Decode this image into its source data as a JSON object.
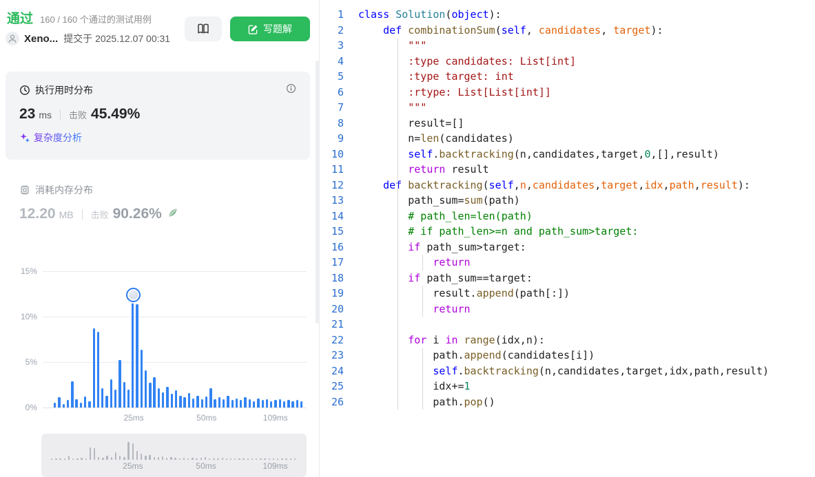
{
  "header": {
    "status": "通过",
    "cases": "160 / 160 个通过的测试用例",
    "username": "Xeno...",
    "submitted": "提交于 2025.12.07 00:31",
    "solution_button": "写题解"
  },
  "runtime": {
    "title": "执行用时分布",
    "value": "23",
    "unit": "ms",
    "beats_label": "击败",
    "beats": "45.49%",
    "complexity_link": "复杂度分析"
  },
  "memory": {
    "title": "消耗内存分布",
    "value": "12.20",
    "unit": "MB",
    "beats_label": "击败",
    "beats": "90.26%"
  },
  "colors": {
    "accent_green": "#2cbb5d",
    "bar_blue": "#3183f3",
    "complexity_gradient": [
      "#7c3aed",
      "#3b82f6"
    ]
  },
  "chart_data": {
    "type": "bar",
    "title": "执行用时分布",
    "x_unit": "ms",
    "ylim": [
      0,
      15.5
    ],
    "grid": true,
    "y_ticks": [
      {
        "label": "15%",
        "value": 15
      },
      {
        "label": "10%",
        "value": 10
      },
      {
        "label": "5%",
        "value": 5
      },
      {
        "label": "0%",
        "value": 0
      }
    ],
    "x_ticks": [
      {
        "label": "25ms",
        "pos": 0.345
      },
      {
        "label": "50ms",
        "pos": 0.621
      },
      {
        "label": "109ms",
        "pos": 0.882
      }
    ],
    "values": [
      0.5,
      1.1,
      0.4,
      0.8,
      2.9,
      0.9,
      0.5,
      1.2,
      0.7,
      8.7,
      8.3,
      2.1,
      1.3,
      3.1,
      2.0,
      5.2,
      2.8,
      2.0,
      12.4,
      11.4,
      6.4,
      4.1,
      2.7,
      3.3,
      2.1,
      1.7,
      2.3,
      1.5,
      1.9,
      1.3,
      1.1,
      1.6,
      1.0,
      1.3,
      0.9,
      1.2,
      2.1,
      0.9,
      1.1,
      0.9,
      1.3,
      0.8,
      1.0,
      0.8,
      1.1,
      0.9,
      0.7,
      1.0,
      0.8,
      0.9,
      0.7,
      0.8,
      0.9,
      0.7,
      0.8,
      0.7,
      0.8,
      0.7
    ],
    "marker_index": 18
  },
  "code": {
    "lines": [
      [
        [
          "kw",
          "class"
        ],
        [
          "p",
          " "
        ],
        [
          "cls",
          "Solution"
        ],
        [
          "p",
          "("
        ],
        [
          "kw",
          "object"
        ],
        [
          "p",
          "):"
        ]
      ],
      [
        [
          "p",
          "    "
        ],
        [
          "kw",
          "def"
        ],
        [
          "p",
          " "
        ],
        [
          "fn",
          "combinationSum"
        ],
        [
          "p",
          "("
        ],
        [
          "kw",
          "self"
        ],
        [
          "p",
          ", "
        ],
        [
          "prm",
          "candidates"
        ],
        [
          "p",
          ", "
        ],
        [
          "prm",
          "target"
        ],
        [
          "p",
          "):"
        ]
      ],
      [
        [
          "str",
          "        \"\"\""
        ]
      ],
      [
        [
          "str",
          "        :type candidates: List[int]"
        ]
      ],
      [
        [
          "str",
          "        :type target: int"
        ]
      ],
      [
        [
          "str",
          "        :rtype: List[List[int]]"
        ]
      ],
      [
        [
          "str",
          "        \"\"\""
        ]
      ],
      [
        [
          "p",
          "        result=[]"
        ]
      ],
      [
        [
          "p",
          "        n="
        ],
        [
          "fn",
          "len"
        ],
        [
          "p",
          "(candidates)"
        ]
      ],
      [
        [
          "p",
          "        "
        ],
        [
          "kw",
          "self"
        ],
        [
          "p",
          "."
        ],
        [
          "fn",
          "backtracking"
        ],
        [
          "p",
          "(n,candidates,target,"
        ],
        [
          "num",
          "0"
        ],
        [
          "p",
          ",[],result)"
        ]
      ],
      [
        [
          "p",
          "        "
        ],
        [
          "ctrl",
          "return"
        ],
        [
          "p",
          " result"
        ]
      ],
      [
        [
          "p",
          "    "
        ],
        [
          "kw",
          "def"
        ],
        [
          "p",
          " "
        ],
        [
          "fn",
          "backtracking"
        ],
        [
          "p",
          "("
        ],
        [
          "kw",
          "self"
        ],
        [
          "p",
          ","
        ],
        [
          "prm",
          "n"
        ],
        [
          "p",
          ","
        ],
        [
          "prm",
          "candidates"
        ],
        [
          "p",
          ","
        ],
        [
          "prm",
          "target"
        ],
        [
          "p",
          ","
        ],
        [
          "prm",
          "idx"
        ],
        [
          "p",
          ","
        ],
        [
          "prm",
          "path"
        ],
        [
          "p",
          ","
        ],
        [
          "prm",
          "result"
        ],
        [
          "p",
          "):"
        ]
      ],
      [
        [
          "p",
          "        path_sum="
        ],
        [
          "fn",
          "sum"
        ],
        [
          "p",
          "(path)"
        ]
      ],
      [
        [
          "com",
          "        # path_len=len(path)"
        ]
      ],
      [
        [
          "com",
          "        # if path_len>=n and path_sum>target:"
        ]
      ],
      [
        [
          "p",
          "        "
        ],
        [
          "ctrl",
          "if"
        ],
        [
          "p",
          " path_sum>target:"
        ]
      ],
      [
        [
          "p",
          "            "
        ],
        [
          "ctrl",
          "return"
        ]
      ],
      [
        [
          "p",
          "        "
        ],
        [
          "ctrl",
          "if"
        ],
        [
          "p",
          " path_sum==target:"
        ]
      ],
      [
        [
          "p",
          "            result."
        ],
        [
          "fn",
          "append"
        ],
        [
          "p",
          "(path[:])"
        ]
      ],
      [
        [
          "p",
          "            "
        ],
        [
          "ctrl",
          "return"
        ]
      ],
      [],
      [
        [
          "p",
          "        "
        ],
        [
          "ctrl",
          "for"
        ],
        [
          "p",
          " i "
        ],
        [
          "ctrl",
          "in"
        ],
        [
          "p",
          " "
        ],
        [
          "fn",
          "range"
        ],
        [
          "p",
          "(idx,n):"
        ]
      ],
      [
        [
          "p",
          "            path."
        ],
        [
          "fn",
          "append"
        ],
        [
          "p",
          "(candidates[i])"
        ]
      ],
      [
        [
          "p",
          "            "
        ],
        [
          "kw",
          "self"
        ],
        [
          "p",
          "."
        ],
        [
          "fn",
          "backtracking"
        ],
        [
          "p",
          "(n,candidates,target,idx,path,result)"
        ]
      ],
      [
        [
          "p",
          "            idx+="
        ],
        [
          "num",
          "1"
        ]
      ],
      [
        [
          "p",
          "            path."
        ],
        [
          "fn",
          "pop"
        ],
        [
          "p",
          "()"
        ]
      ]
    ]
  }
}
